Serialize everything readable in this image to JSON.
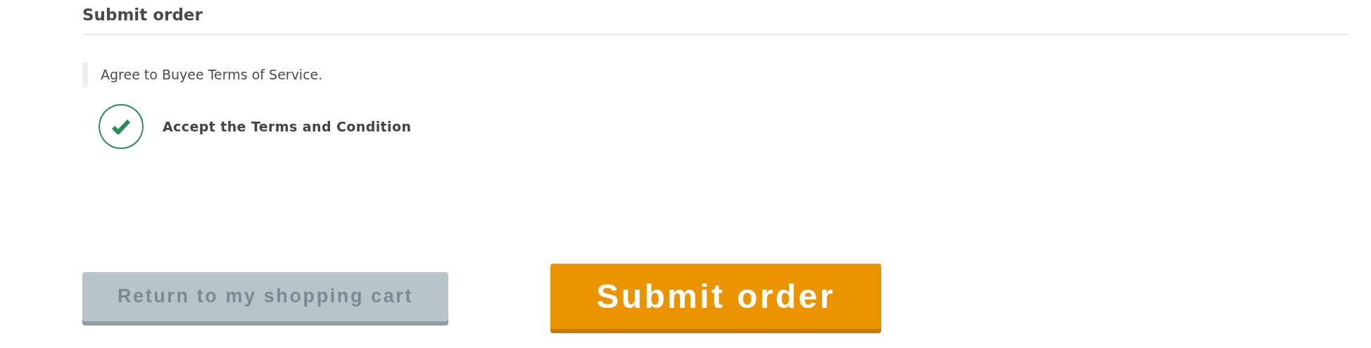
{
  "section": {
    "title": "Submit order"
  },
  "notice": "Agree to Buyee Terms of Service.",
  "agreement": {
    "label": "Accept the Terms and Condition",
    "checked": true
  },
  "buttons": [
    {
      "label": "Return to my shopping cart",
      "kind": "secondary"
    },
    {
      "label": "Submit order",
      "kind": "primary"
    }
  ]
}
